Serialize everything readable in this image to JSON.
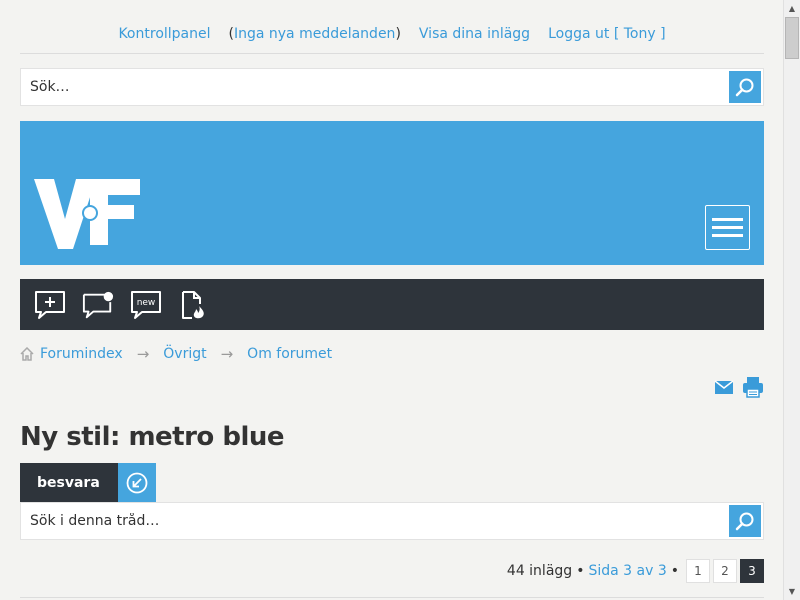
{
  "top_links": {
    "control_panel": "Kontrollpanel",
    "no_new_messages": "Inga nya meddelanden",
    "view_posts": "Visa dina inlägg",
    "logout": "Logga ut [ Tony ]"
  },
  "search": {
    "placeholder": "Sök…"
  },
  "header": {
    "logo_alt": "VF"
  },
  "toolbar": {
    "icons": [
      "new-post-icon",
      "notification-icon",
      "new-topics-icon",
      "hot-topics-icon"
    ],
    "new_label": "new"
  },
  "breadcrumb": {
    "items": [
      "Forumindex",
      "Övrigt",
      "Om forumet"
    ]
  },
  "topic": {
    "title": "Ny stil: metro blue",
    "reply_label": "besvara",
    "search_placeholder": "Sök i denna tråd…"
  },
  "pagination": {
    "post_count": "44 inlägg",
    "page_info": "Sida 3 av 3",
    "pages": [
      "1",
      "2",
      "3"
    ],
    "current_page": "3"
  },
  "colors": {
    "accent": "#45a5de",
    "dark": "#2e343b",
    "link": "#3a9bd9",
    "background": "#f3f3f1"
  }
}
